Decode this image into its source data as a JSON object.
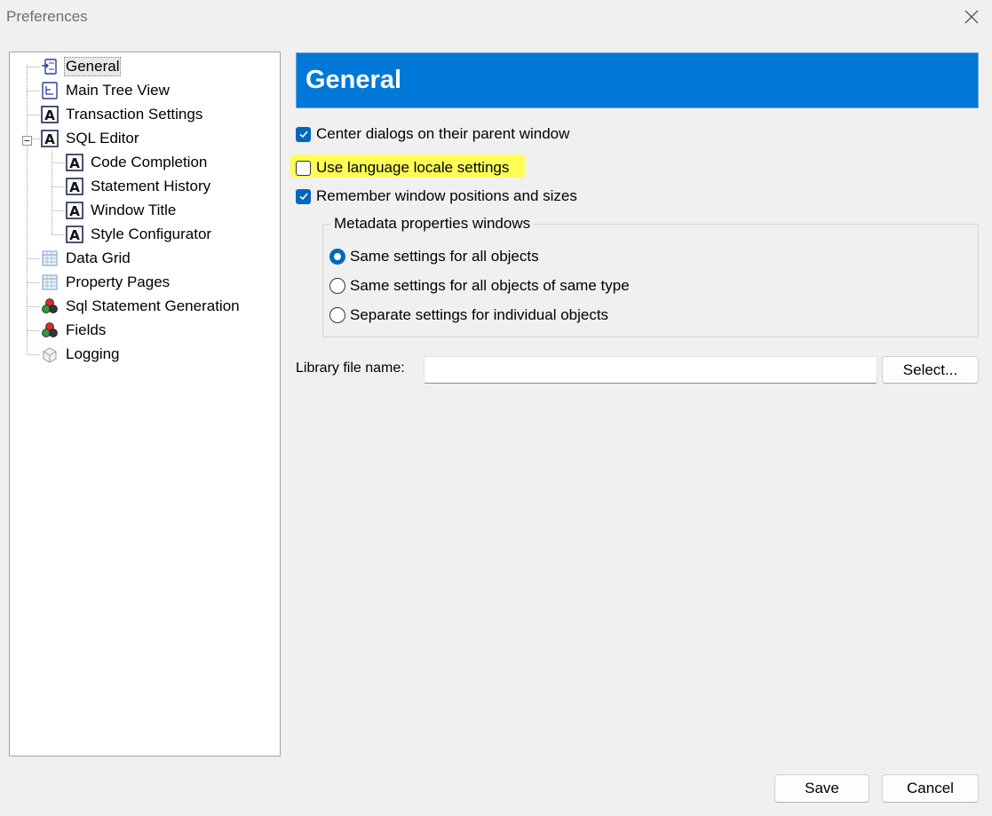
{
  "window": {
    "title": "Preferences"
  },
  "tree": {
    "items": [
      {
        "label": "General",
        "icon": "general-page-icon"
      },
      {
        "label": "Main Tree View",
        "icon": "tree-view-icon"
      },
      {
        "label": "Transaction Settings",
        "icon": "letter-a-icon"
      },
      {
        "label": "SQL Editor",
        "icon": "letter-a-icon"
      },
      {
        "label": "Code Completion",
        "icon": "letter-a-icon"
      },
      {
        "label": "Statement History",
        "icon": "letter-a-icon"
      },
      {
        "label": "Window Title",
        "icon": "letter-a-icon"
      },
      {
        "label": "Style Configurator",
        "icon": "letter-a-icon"
      },
      {
        "label": "Data Grid",
        "icon": "grid-icon"
      },
      {
        "label": "Property Pages",
        "icon": "grid-icon"
      },
      {
        "label": "Sql Statement Generation",
        "icon": "shapes-icon"
      },
      {
        "label": "Fields",
        "icon": "shapes-icon"
      },
      {
        "label": "Logging",
        "icon": "box-icon"
      }
    ]
  },
  "page": {
    "header": "General",
    "options": [
      {
        "label": "Center dialogs on their parent window",
        "checked": true
      },
      {
        "label": "Use language locale settings",
        "checked": false
      },
      {
        "label": "Remember window positions and sizes",
        "checked": true
      }
    ],
    "metadata_group": {
      "title": "Metadata properties windows",
      "radios": [
        {
          "label": "Same settings for all objects",
          "selected": true
        },
        {
          "label": "Same settings for all objects of same type",
          "selected": false
        },
        {
          "label": "Separate settings for individual objects",
          "selected": false
        }
      ]
    },
    "library": {
      "label": "Library file name:",
      "value": "",
      "button": "Select..."
    }
  },
  "footer": {
    "save": "Save",
    "cancel": "Cancel"
  },
  "colors": {
    "accent": "#0078d7",
    "checkbox": "#0067c0",
    "highlight": "#ffff3a"
  }
}
